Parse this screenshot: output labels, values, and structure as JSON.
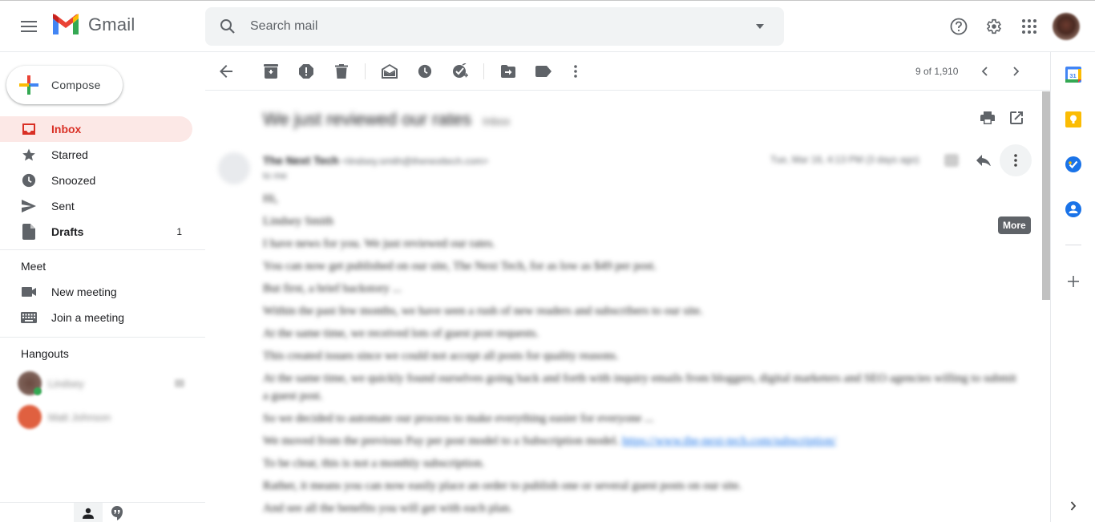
{
  "header": {
    "app_name": "Gmail",
    "search_placeholder": "Search mail"
  },
  "sidebar": {
    "compose_label": "Compose",
    "nav_items": [
      {
        "label": "Inbox",
        "icon": "inbox-icon",
        "active": true,
        "count": ""
      },
      {
        "label": "Starred",
        "icon": "star-icon",
        "active": false,
        "count": ""
      },
      {
        "label": "Snoozed",
        "icon": "clock-icon",
        "active": false,
        "count": ""
      },
      {
        "label": "Sent",
        "icon": "send-icon",
        "active": false,
        "count": ""
      },
      {
        "label": "Drafts",
        "icon": "draft-icon",
        "active": false,
        "count": "1"
      }
    ],
    "meet": {
      "title": "Meet",
      "items": [
        {
          "label": "New meeting",
          "icon": "video-camera-icon"
        },
        {
          "label": "Join a meeting",
          "icon": "keyboard-icon"
        }
      ]
    },
    "hangouts": {
      "title": "Hangouts",
      "contacts": [
        {
          "name": "Lindsey",
          "status": "online"
        },
        {
          "name": "Matt Johnson",
          "status": ""
        }
      ]
    }
  },
  "toolbar": {
    "pager_text": "9 of 1,910",
    "icons": [
      "back-arrow-icon",
      "archive-icon",
      "report-spam-icon",
      "delete-icon",
      "mark-unread-icon",
      "snooze-icon",
      "add-to-tasks-icon",
      "move-to-icon",
      "label-icon",
      "more-vert-icon"
    ]
  },
  "message": {
    "subject": "We just reviewed our rates",
    "subject_labels": "Inbox",
    "sender_name": "The Next Tech",
    "sender_email": "<lindsey.smith@thenexttech.com>",
    "to_line": "to me",
    "date": "Tue, Mar 16, 4:13 PM (3 days ago)",
    "tooltip": "More",
    "body_lines": [
      "Hi,",
      "Lindsey Smith",
      "I have news for you. We just reviewed our rates.",
      "You can now get published on our site, The Next Tech, for as low as $49 per post.",
      "But first, a brief backstory ...",
      "Within the past few months, we have seen a rush of new readers and subscribers to our site.",
      "At the same time, we received lots of guest post requests.",
      "This created issues since we could not accept all posts for quality reasons.",
      "At the same time, we quickly found ourselves going back and forth with inquiry emails from bloggers, digital marketers and SEO agencies willing to submit a guest post.",
      "So we decided to automate our process to make everything easier for everyone ...",
      "We moved from the previous Pay per post model to a Subscription model.",
      "To be clear, this is not a monthly subscription.",
      "Rather, it means you can now easily place an order to publish one or several guest posts on our site.",
      "And see all the benefits you will get with each plan."
    ],
    "link_text": "https://www.the-next-tech.com/subscription/"
  },
  "side_panel": {
    "apps": [
      "Calendar",
      "Keep",
      "Tasks",
      "Contacts"
    ],
    "add_label": "Get add-ons"
  }
}
